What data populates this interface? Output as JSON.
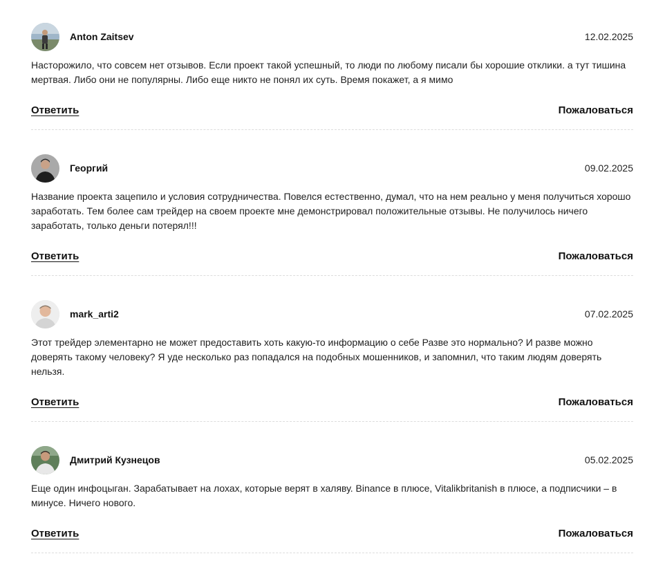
{
  "comments": [
    {
      "author": "Anton Zaitsev",
      "date": "12.02.2025",
      "text": "Насторожило, что совсем нет отзывов. Если проект такой успешный, то люди по любому писали бы хорошие отклики. а тут тишина мертвая. Либо они не популярны. Либо еще никто не понял их суть. Время покажет, а я мимо",
      "reply_label": "Ответить",
      "report_label": "Пожаловаться"
    },
    {
      "author": "Георгий",
      "date": "09.02.2025",
      "text": "Название проекта зацепило и условия сотрудничества. Повелся естественно, думал, что на нем реально у меня получиться хорошо заработать. Тем более сам трейдер на своем проекте мне демонстрировал положительные отзывы. Не получилось ничего заработать, только деньги потерял!!!",
      "reply_label": "Ответить",
      "report_label": "Пожаловаться"
    },
    {
      "author": "mark_arti2",
      "date": "07.02.2025",
      "text": "Этот трейдер элементарно не может предоставить хоть какую-то информацию о себе Разве это нормально? И разве можно доверять такому человеку? Я уде несколько раз попадался на подобных мошенников, и запомнил, что таким людям доверять нельзя.",
      "reply_label": "Ответить",
      "report_label": "Пожаловаться"
    },
    {
      "author": "Дмитрий Кузнецов",
      "date": "05.02.2025",
      "text": "Еще один инфоцыган. Зарабатывает на лохах, которые верят в халяву. Binance в плюсе, Vitalikbritanish в плюсе, а подписчики – в минусе. Ничего нового.",
      "reply_label": "Ответить",
      "report_label": "Пожаловаться"
    }
  ]
}
